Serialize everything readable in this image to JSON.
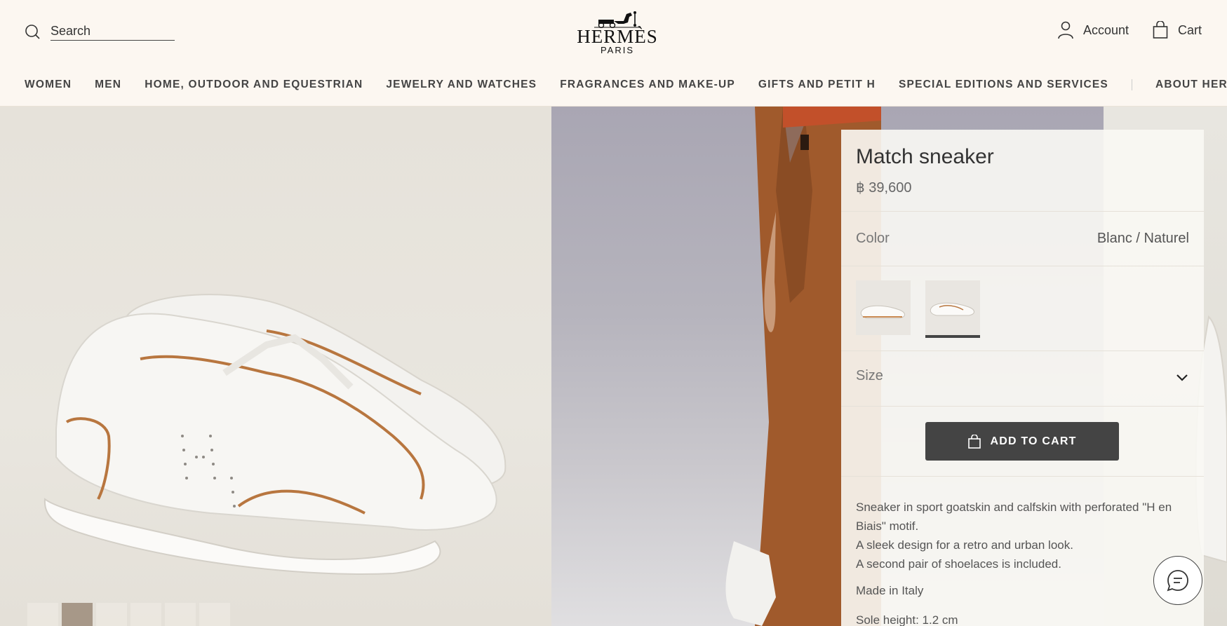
{
  "header": {
    "search_placeholder": "Search",
    "logo_brand": "HERMÈS",
    "logo_city": "PARIS",
    "account_label": "Account",
    "cart_label": "Cart"
  },
  "nav": {
    "items": [
      "WOMEN",
      "MEN",
      "HOME, OUTDOOR AND EQUESTRIAN",
      "JEWELRY AND WATCHES",
      "FRAGRANCES AND MAKE-UP",
      "GIFTS AND PETIT H",
      "SPECIAL EDITIONS AND SERVICES"
    ],
    "about": "ABOUT HERMÈS"
  },
  "gallery": {
    "thumbnail_count": 6,
    "active_thumbnail": 2
  },
  "product": {
    "name": "Match sneaker",
    "price": "฿ 39,600",
    "color_label": "Color",
    "color_value": "Blanc / Naturel",
    "selected_swatch": 2,
    "size_label": "Size",
    "add_to_cart": "ADD TO CART",
    "description": [
      "Sneaker in sport goatskin and calfskin with perforated \"H en Biais\" motif.",
      "A sleek design for a retro and urban look.",
      "A second pair of shoelaces is included."
    ],
    "made_in": "Made in Italy",
    "sole_height": "Sole height: 1.2 cm"
  },
  "colors": {
    "header_bg": "#fcf7f1",
    "button_bg": "#444444",
    "accent_leather": "#b8763f"
  }
}
